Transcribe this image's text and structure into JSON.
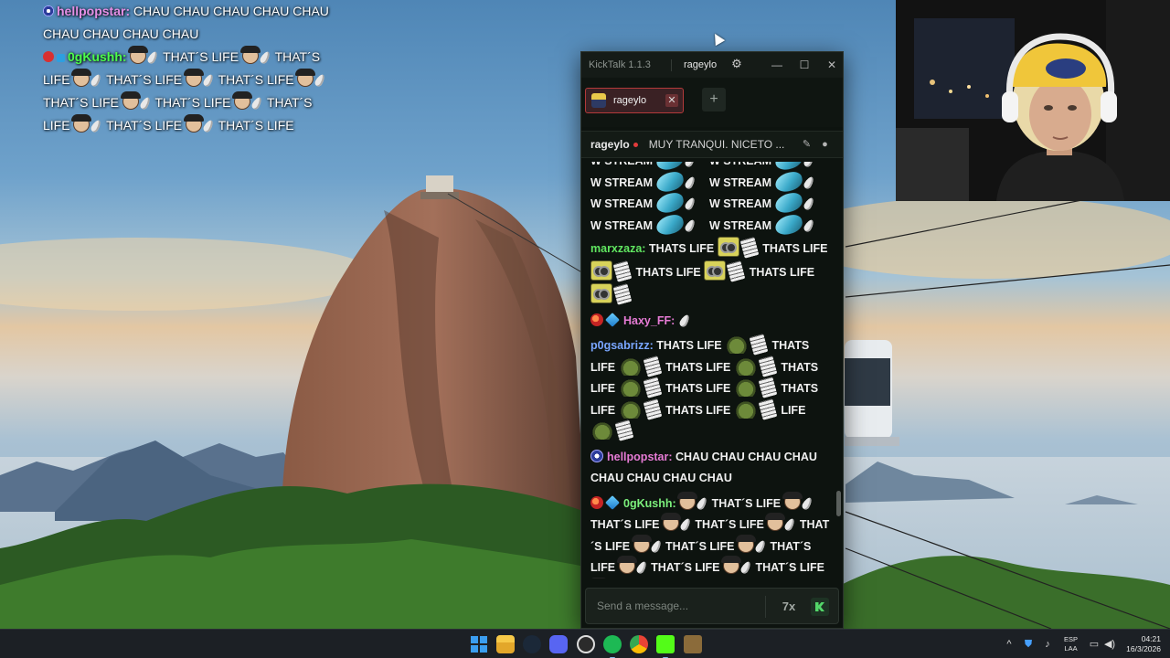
{
  "overlay_chat": {
    "msg1_user": "hellpopstar:",
    "msg1_text": "CHAU CHAU CHAU CHAU CHAU CHAU CHAU CHAU CHAU",
    "msg2_user": "0gKushh:",
    "msg2_chunk": "THAT´S LIFE",
    "msg2_tail": "LIFE"
  },
  "app": {
    "title": "KickTalk 1.1.3",
    "user_name": "rageylo",
    "tab_label": "rageylo",
    "channel_name": "rageylo",
    "stream_title": "MUY TRANQUI. NICETO ...",
    "composer_placeholder": "Send a message..."
  },
  "chat": {
    "stream_text": "W STREAM",
    "thats_life": "THATS LIFE",
    "thats_life_apos": "THAT´S LIFE",
    "life": "LIFE",
    "messages": [
      {
        "user": "marxzaza:"
      },
      {
        "user": "Haxy_FF:"
      },
      {
        "user": "p0gsabrizz:"
      },
      {
        "user": "hellpopstar:",
        "text": "CHAU CHAU CHAU CHAU CHAU CHAU CHAU CHAU"
      },
      {
        "user": "0gKushh:"
      }
    ]
  },
  "taskbar": {
    "lang_top": "ESP",
    "lang_bottom": "LAA",
    "time": "04:21",
    "date": "16/3/2026"
  },
  "colors": {
    "accent_green": "#53d769",
    "tab_border": "#b33a3a"
  }
}
